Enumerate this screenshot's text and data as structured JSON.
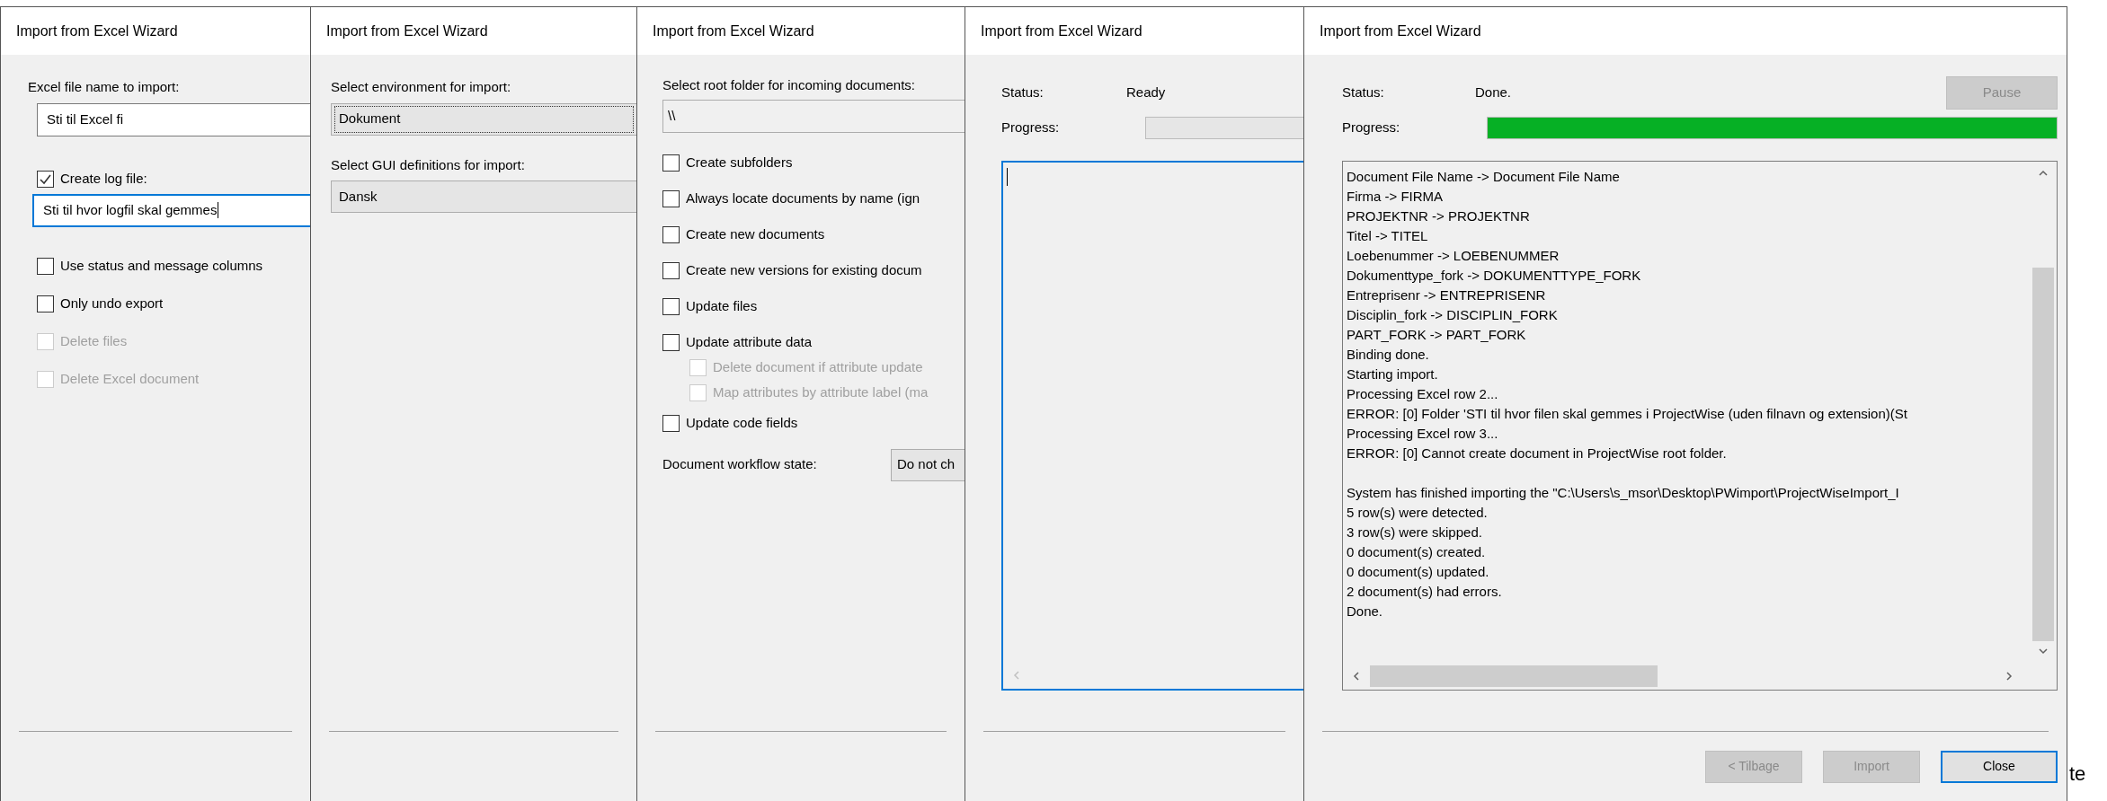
{
  "windows": [
    {
      "kind": "source",
      "title": "Import from Excel Wizard",
      "file_label": "Excel file name to import:",
      "file_field": {
        "value": "Sti til Excel fi",
        "focused": false
      },
      "log_checkbox": {
        "label": "Create log file:",
        "checked": true,
        "disabled": false
      },
      "log_field": {
        "value": "Sti til hvor logfil skal gemmes",
        "focused": true
      },
      "options": [
        {
          "label": "Use status and message columns",
          "checked": false,
          "disabled": false
        },
        {
          "label": "Only undo export",
          "checked": false,
          "disabled": false
        },
        {
          "label": "Delete files",
          "checked": false,
          "disabled": true
        },
        {
          "label": "Delete Excel document",
          "checked": false,
          "disabled": true
        }
      ]
    },
    {
      "kind": "environment",
      "title": "Import from Excel Wizard",
      "fields": [
        {
          "label": "Select environment for import:",
          "value": "Dokument",
          "focused": true
        },
        {
          "label": "Select GUI definitions for import:",
          "value": "Dansk",
          "focused": false
        }
      ]
    },
    {
      "kind": "folders",
      "title": "Import from Excel Wizard",
      "folder_label": "Select root folder for incoming documents:",
      "folder_value": "\\\\",
      "options": [
        {
          "label": "Create subfolders",
          "checked": false,
          "disabled": false
        },
        {
          "label": "Always locate documents by name (ign",
          "checked": false,
          "disabled": false
        },
        {
          "label": "Create new documents",
          "checked": false,
          "disabled": false
        },
        {
          "label": "Create new versions for existing docum",
          "checked": false,
          "disabled": false
        },
        {
          "label": "Update files",
          "checked": false,
          "disabled": false
        },
        {
          "label": "Update attribute data",
          "checked": false,
          "disabled": false,
          "children": [
            {
              "label": "Delete document if attribute update",
              "checked": false,
              "disabled": true
            },
            {
              "label": "Map attributes by attribute label (ma",
              "checked": false,
              "disabled": true
            }
          ]
        },
        {
          "label": "Update code fields",
          "checked": false,
          "disabled": false
        }
      ],
      "workflow_label": "Document workflow state:",
      "workflow_value": "Do not ch"
    },
    {
      "kind": "progress",
      "title": "Import from Excel Wizard",
      "status_label": "Status:",
      "status_value": "Ready",
      "progress_label": "Progress:",
      "progress": {
        "level": 0
      },
      "log": {
        "focused": true
      }
    },
    {
      "kind": "progress",
      "title": "Import from Excel Wizard",
      "status_label": "Status:",
      "status_value": "Done.",
      "pause_button": {
        "label": "Pause",
        "disabled": true
      },
      "progress_label": "Progress:",
      "progress": {
        "level": 1
      },
      "log": {
        "focused": false,
        "blocks": [
          [
            "Document File Name -> Document File Name",
            "Firma -> FIRMA",
            "PROJEKTNR -> PROJEKTNR",
            "Titel -> TITEL",
            "Loebenummer -> LOEBENUMMER",
            "Dokumenttype_fork -> DOKUMENTTYPE_FORK",
            "Entreprisenr -> ENTREPRISENR",
            "Disciplin_fork -> DISCIPLIN_FORK",
            "PART_FORK -> PART_FORK",
            "Binding done.",
            "Starting import.",
            "Processing Excel row 2...",
            "ERROR: [0] Folder 'STI til hvor filen skal gemmes i ProjectWise (uden filnavn og extension)(St",
            "Processing Excel row 3...",
            "ERROR: [0] Cannot create document in ProjectWise root folder."
          ],
          [
            "System has finished importing the \"C:\\Users\\s_msor\\Desktop\\PWimport\\ProjectWiseImport_I",
            "5 row(s) were detected.",
            "3 row(s) were skipped.",
            "0 document(s) created.",
            "0 document(s) updated.",
            "2 document(s) had errors.",
            "Done."
          ]
        ]
      },
      "buttons": [
        {
          "label": "< Tilbage",
          "disabled": true,
          "default": false
        },
        {
          "label": "Import",
          "disabled": true,
          "default": false
        },
        {
          "label": "Close",
          "disabled": false,
          "default": true
        }
      ]
    }
  ],
  "background_text": "te"
}
